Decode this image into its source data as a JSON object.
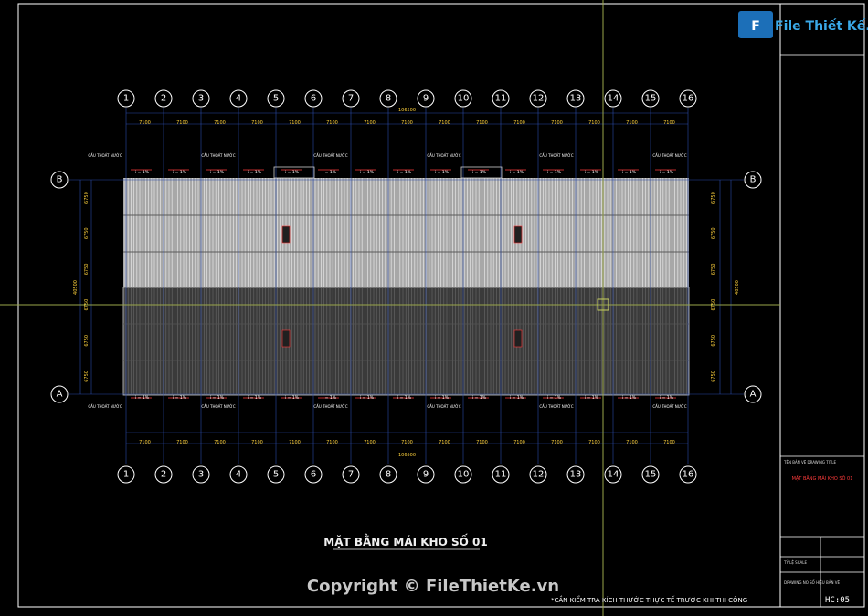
{
  "drawing": {
    "title": "MẶT BẰNG MÁI KHO SỐ 01",
    "copyright": "Copyright © FileThietKe.vn",
    "note": "*CẦN KIỂM TRA KÍCH THƯỚC THỰC TẾ TRƯỚC KHI THI CÔNG"
  },
  "grid": {
    "columns": [
      "1",
      "2",
      "3",
      "4",
      "5",
      "6",
      "7",
      "8",
      "9",
      "10",
      "11",
      "12",
      "13",
      "14",
      "15",
      "16"
    ],
    "rows": [
      "B",
      "A"
    ],
    "bay_dim": "7100",
    "total_dim": "106500",
    "vertical_dims": [
      "6750",
      "6750",
      "6750",
      "6750",
      "6750",
      "6750"
    ],
    "vertical_total": "40500",
    "gutter_label": "CẦU THOÁT NƯỚC",
    "slope_label": "i = 1%"
  },
  "title_block": {
    "logo": "File Thiết Kế.vn",
    "drawing_name_label": "TÊN BẢN VẼ DRAWING TITLE",
    "drawing_name": "MẶT BẰNG MÁI KHO SỐ 01",
    "scale_label": "TỶ LỆ SCALE",
    "drawing_no_label": "DRAWING NO SỐ HIỆU BẢN VẼ",
    "drawing_no": "HC:05"
  },
  "colors": {
    "background": "#000000",
    "grid_line": "#2a4aa8",
    "crosshair": "#9aa64a",
    "dimension_text": "#ffd23c",
    "roof_top": "#a8a8a8",
    "roof_bottom": "#3a3a3a",
    "accent_red": "#ff3b3b"
  }
}
